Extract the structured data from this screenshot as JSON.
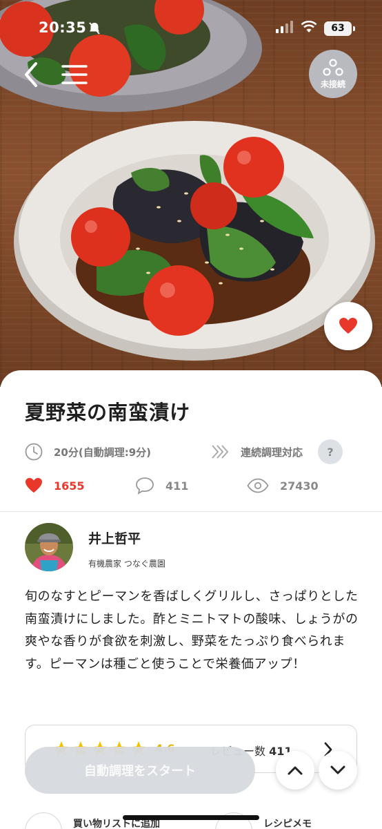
{
  "status_bar": {
    "time": "20:35",
    "battery": "63"
  },
  "nav": {
    "connection_label": "未接続"
  },
  "recipe": {
    "title": "夏野菜の南蛮漬け",
    "time": "20分(自動調理:9分)",
    "continuous_label": "連続調理対応",
    "help": "?",
    "likes": "1655",
    "comments": "411",
    "views": "27430",
    "description": "旬のなすとピーマンを香ばしくグリルし、さっぱりとした南蛮漬けにしました。酢とミニトマトの酸味、しょうがの爽やな香りが食欲を刺激し、野菜をたっぷり食べられます。ピーマンは種ごと使うことで栄養価アップ！"
  },
  "author": {
    "name": "井上哲平",
    "org": "有機農家 つなぐ農園"
  },
  "review": {
    "rating": "4.6",
    "count_label": "レビュー数",
    "count": "411"
  },
  "actions": {
    "start": "自動調理をスタート",
    "shopping": "買い物リストに追加",
    "memo": "レシピメモ"
  },
  "colors": {
    "accent_red": "#e8382c",
    "star": "#f2c200",
    "disabled_button": "#d6dade"
  }
}
